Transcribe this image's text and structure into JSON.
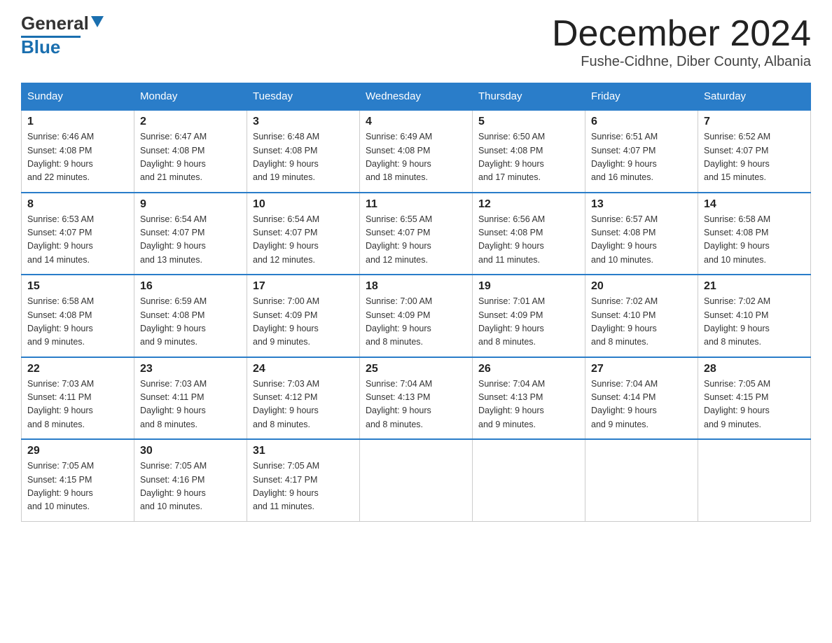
{
  "logo": {
    "general": "General",
    "blue": "Blue"
  },
  "title": "December 2024",
  "location": "Fushe-Cidhne, Diber County, Albania",
  "days_of_week": [
    "Sunday",
    "Monday",
    "Tuesday",
    "Wednesday",
    "Thursday",
    "Friday",
    "Saturday"
  ],
  "weeks": [
    [
      {
        "day": "1",
        "sunrise": "6:46 AM",
        "sunset": "4:08 PM",
        "daylight": "9 hours and 22 minutes."
      },
      {
        "day": "2",
        "sunrise": "6:47 AM",
        "sunset": "4:08 PM",
        "daylight": "9 hours and 21 minutes."
      },
      {
        "day": "3",
        "sunrise": "6:48 AM",
        "sunset": "4:08 PM",
        "daylight": "9 hours and 19 minutes."
      },
      {
        "day": "4",
        "sunrise": "6:49 AM",
        "sunset": "4:08 PM",
        "daylight": "9 hours and 18 minutes."
      },
      {
        "day": "5",
        "sunrise": "6:50 AM",
        "sunset": "4:08 PM",
        "daylight": "9 hours and 17 minutes."
      },
      {
        "day": "6",
        "sunrise": "6:51 AM",
        "sunset": "4:07 PM",
        "daylight": "9 hours and 16 minutes."
      },
      {
        "day": "7",
        "sunrise": "6:52 AM",
        "sunset": "4:07 PM",
        "daylight": "9 hours and 15 minutes."
      }
    ],
    [
      {
        "day": "8",
        "sunrise": "6:53 AM",
        "sunset": "4:07 PM",
        "daylight": "9 hours and 14 minutes."
      },
      {
        "day": "9",
        "sunrise": "6:54 AM",
        "sunset": "4:07 PM",
        "daylight": "9 hours and 13 minutes."
      },
      {
        "day": "10",
        "sunrise": "6:54 AM",
        "sunset": "4:07 PM",
        "daylight": "9 hours and 12 minutes."
      },
      {
        "day": "11",
        "sunrise": "6:55 AM",
        "sunset": "4:07 PM",
        "daylight": "9 hours and 12 minutes."
      },
      {
        "day": "12",
        "sunrise": "6:56 AM",
        "sunset": "4:08 PM",
        "daylight": "9 hours and 11 minutes."
      },
      {
        "day": "13",
        "sunrise": "6:57 AM",
        "sunset": "4:08 PM",
        "daylight": "9 hours and 10 minutes."
      },
      {
        "day": "14",
        "sunrise": "6:58 AM",
        "sunset": "4:08 PM",
        "daylight": "9 hours and 10 minutes."
      }
    ],
    [
      {
        "day": "15",
        "sunrise": "6:58 AM",
        "sunset": "4:08 PM",
        "daylight": "9 hours and 9 minutes."
      },
      {
        "day": "16",
        "sunrise": "6:59 AM",
        "sunset": "4:08 PM",
        "daylight": "9 hours and 9 minutes."
      },
      {
        "day": "17",
        "sunrise": "7:00 AM",
        "sunset": "4:09 PM",
        "daylight": "9 hours and 9 minutes."
      },
      {
        "day": "18",
        "sunrise": "7:00 AM",
        "sunset": "4:09 PM",
        "daylight": "9 hours and 8 minutes."
      },
      {
        "day": "19",
        "sunrise": "7:01 AM",
        "sunset": "4:09 PM",
        "daylight": "9 hours and 8 minutes."
      },
      {
        "day": "20",
        "sunrise": "7:02 AM",
        "sunset": "4:10 PM",
        "daylight": "9 hours and 8 minutes."
      },
      {
        "day": "21",
        "sunrise": "7:02 AM",
        "sunset": "4:10 PM",
        "daylight": "9 hours and 8 minutes."
      }
    ],
    [
      {
        "day": "22",
        "sunrise": "7:03 AM",
        "sunset": "4:11 PM",
        "daylight": "9 hours and 8 minutes."
      },
      {
        "day": "23",
        "sunrise": "7:03 AM",
        "sunset": "4:11 PM",
        "daylight": "9 hours and 8 minutes."
      },
      {
        "day": "24",
        "sunrise": "7:03 AM",
        "sunset": "4:12 PM",
        "daylight": "9 hours and 8 minutes."
      },
      {
        "day": "25",
        "sunrise": "7:04 AM",
        "sunset": "4:13 PM",
        "daylight": "9 hours and 8 minutes."
      },
      {
        "day": "26",
        "sunrise": "7:04 AM",
        "sunset": "4:13 PM",
        "daylight": "9 hours and 9 minutes."
      },
      {
        "day": "27",
        "sunrise": "7:04 AM",
        "sunset": "4:14 PM",
        "daylight": "9 hours and 9 minutes."
      },
      {
        "day": "28",
        "sunrise": "7:05 AM",
        "sunset": "4:15 PM",
        "daylight": "9 hours and 9 minutes."
      }
    ],
    [
      {
        "day": "29",
        "sunrise": "7:05 AM",
        "sunset": "4:15 PM",
        "daylight": "9 hours and 10 minutes."
      },
      {
        "day": "30",
        "sunrise": "7:05 AM",
        "sunset": "4:16 PM",
        "daylight": "9 hours and 10 minutes."
      },
      {
        "day": "31",
        "sunrise": "7:05 AM",
        "sunset": "4:17 PM",
        "daylight": "9 hours and 11 minutes."
      },
      null,
      null,
      null,
      null
    ]
  ]
}
